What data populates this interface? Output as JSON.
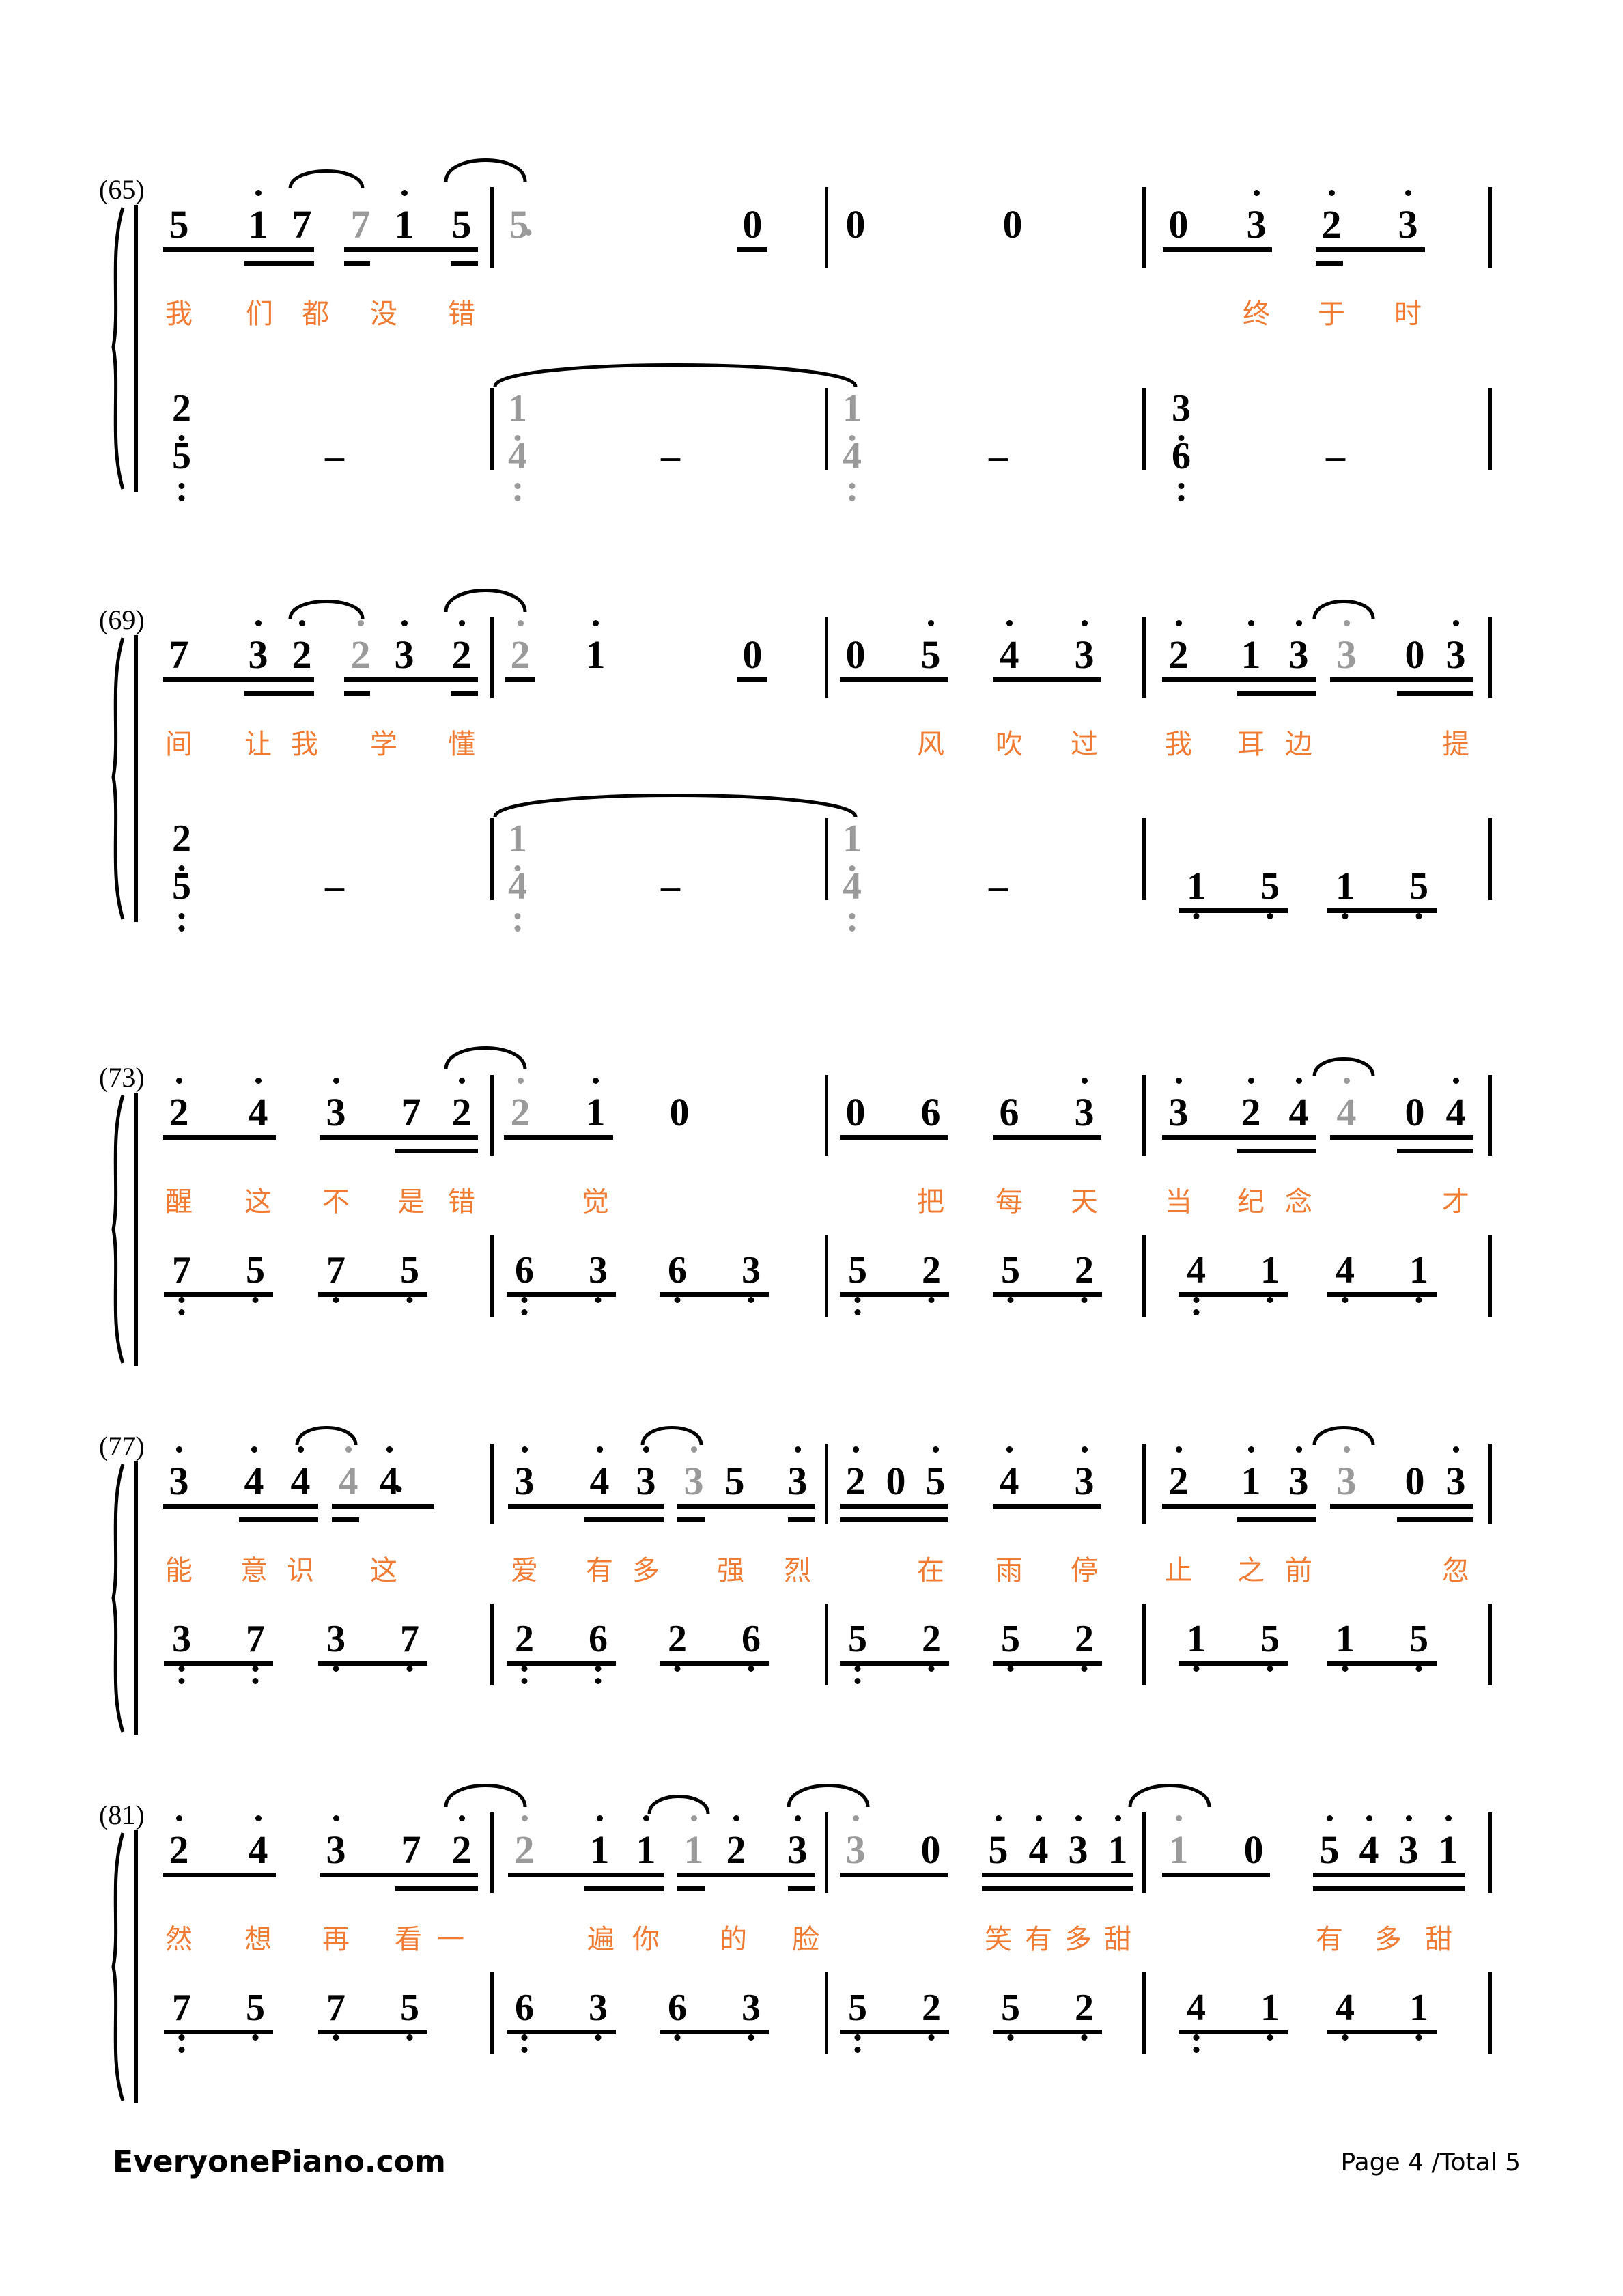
{
  "document": {
    "type": "numbered-musical-notation-piano-score",
    "page_label": "Page 4 /Total 5",
    "brand": "EveryonePiano.com",
    "accent_color": "#F07B33",
    "tied_note_color": "#9A9A9A"
  },
  "systems": [
    {
      "measure_number": "(65)",
      "melody_lyrics": [
        "我",
        "们",
        "都",
        "没",
        "错",
        "终",
        "于",
        "时"
      ],
      "melody_notes": [
        {
          "d": "5"
        },
        {
          "d": "1",
          "oct": "up"
        },
        {
          "d": "7"
        },
        {
          "d": "7",
          "tied": true
        },
        {
          "d": "1",
          "oct": "up"
        },
        {
          "d": "5"
        },
        {
          "d": "5",
          "tied": true,
          "dot": true
        },
        {
          "d": "0"
        },
        {
          "d": "0"
        },
        {
          "d": "0"
        },
        {
          "d": "0"
        },
        {
          "d": "3",
          "oct": "up"
        },
        {
          "d": "2",
          "oct": "up"
        },
        {
          "d": "3",
          "oct": "up"
        }
      ],
      "bass_notes": [
        {
          "d": "2",
          "oct": "dn1"
        },
        {
          "d": "5",
          "oct": "dn2"
        },
        {
          "d": "-"
        },
        {
          "d": "1",
          "oct": "dn1",
          "tied": true
        },
        {
          "d": "4",
          "oct": "dn2",
          "tied": true
        },
        {
          "d": "-"
        },
        {
          "d": "1",
          "oct": "dn1",
          "tied": true
        },
        {
          "d": "4",
          "oct": "dn2",
          "tied": true
        },
        {
          "d": "-"
        },
        {
          "d": "3",
          "oct": "dn1"
        },
        {
          "d": "6",
          "oct": "dn2"
        },
        {
          "d": "-"
        }
      ]
    },
    {
      "measure_number": "(69)",
      "melody_lyrics": [
        "间",
        "让",
        "我",
        "学",
        "懂",
        "风",
        "吹",
        "过",
        "我",
        "耳",
        "边",
        "提"
      ],
      "melody_notes": [
        {
          "d": "7"
        },
        {
          "d": "3",
          "oct": "up"
        },
        {
          "d": "2",
          "oct": "up"
        },
        {
          "d": "2",
          "oct": "up",
          "tied": true
        },
        {
          "d": "3"
        },
        {
          "d": "2",
          "oct": "up"
        },
        {
          "d": "2",
          "oct": "up",
          "tied": true
        },
        {
          "d": "1",
          "oct": "up"
        },
        {
          "d": "0"
        },
        {
          "d": "0"
        },
        {
          "d": "5",
          "oct": "up"
        },
        {
          "d": "4",
          "oct": "up"
        },
        {
          "d": "3",
          "oct": "up"
        },
        {
          "d": "2",
          "oct": "up"
        },
        {
          "d": "1",
          "oct": "up"
        },
        {
          "d": "3",
          "oct": "up"
        },
        {
          "d": "3",
          "oct": "up",
          "tied": true
        },
        {
          "d": "0"
        },
        {
          "d": "3",
          "oct": "up"
        }
      ],
      "bass_notes": [
        {
          "d": "2",
          "oct": "dn1"
        },
        {
          "d": "5",
          "oct": "dn2"
        },
        {
          "d": "-"
        },
        {
          "d": "1",
          "oct": "dn1",
          "tied": true
        },
        {
          "d": "4",
          "oct": "dn2",
          "tied": true
        },
        {
          "d": "-"
        },
        {
          "d": "1",
          "oct": "dn1",
          "tied": true
        },
        {
          "d": "4",
          "oct": "dn2",
          "tied": true
        },
        {
          "d": "-"
        },
        {
          "d": "1",
          "oct": "dn1"
        },
        {
          "d": "5",
          "oct": "dn1"
        },
        {
          "d": "1",
          "oct": "dn1"
        },
        {
          "d": "5",
          "oct": "dn1"
        }
      ]
    },
    {
      "measure_number": "(73)",
      "melody_lyrics": [
        "醒",
        "这",
        "不",
        "是",
        "错",
        "觉",
        "把",
        "每",
        "天",
        "当",
        "纪",
        "念",
        "才"
      ],
      "melody_notes": [
        {
          "d": "2",
          "oct": "up"
        },
        {
          "d": "4",
          "oct": "up"
        },
        {
          "d": "3",
          "oct": "up"
        },
        {
          "d": "7"
        },
        {
          "d": "2",
          "oct": "up"
        },
        {
          "d": "2",
          "oct": "up",
          "tied": true
        },
        {
          "d": "1",
          "oct": "up"
        },
        {
          "d": "0"
        },
        {
          "d": "0"
        },
        {
          "d": "6"
        },
        {
          "d": "6"
        },
        {
          "d": "3",
          "oct": "up"
        },
        {
          "d": "3",
          "oct": "up"
        },
        {
          "d": "2",
          "oct": "up"
        },
        {
          "d": "4",
          "oct": "up"
        },
        {
          "d": "4",
          "oct": "up",
          "tied": true
        },
        {
          "d": "0"
        },
        {
          "d": "4",
          "oct": "up"
        }
      ],
      "bass_notes": [
        {
          "d": "7",
          "oct": "dn2"
        },
        {
          "d": "5",
          "oct": "dn1"
        },
        {
          "d": "7",
          "oct": "dn1"
        },
        {
          "d": "5",
          "oct": "dn1"
        },
        {
          "d": "6",
          "oct": "dn2"
        },
        {
          "d": "3",
          "oct": "dn1"
        },
        {
          "d": "6",
          "oct": "dn1"
        },
        {
          "d": "3",
          "oct": "dn1"
        },
        {
          "d": "5",
          "oct": "dn2"
        },
        {
          "d": "2",
          "oct": "dn1"
        },
        {
          "d": "5",
          "oct": "dn1"
        },
        {
          "d": "2",
          "oct": "dn1"
        },
        {
          "d": "4",
          "oct": "dn2"
        },
        {
          "d": "1",
          "oct": "dn1"
        },
        {
          "d": "4",
          "oct": "dn1"
        },
        {
          "d": "1",
          "oct": "dn1"
        }
      ]
    },
    {
      "measure_number": "(77)",
      "melody_lyrics": [
        "能",
        "意",
        "识",
        "这",
        "爱",
        "有",
        "多",
        "强",
        "烈",
        "在",
        "雨",
        "停",
        "止",
        "之",
        "前",
        "忽"
      ],
      "melody_notes": [
        {
          "d": "3",
          "oct": "up"
        },
        {
          "d": "4",
          "oct": "up"
        },
        {
          "d": "4",
          "oct": "up"
        },
        {
          "d": "4",
          "oct": "up",
          "tied": true
        },
        {
          "d": "4",
          "oct": "up",
          "dot": true
        },
        {
          "d": "3",
          "oct": "up"
        },
        {
          "d": "4",
          "oct": "up"
        },
        {
          "d": "3",
          "oct": "up"
        },
        {
          "d": "3",
          "oct": "up",
          "tied": true
        },
        {
          "d": "5"
        },
        {
          "d": "3",
          "oct": "up"
        },
        {
          "d": "2",
          "oct": "up"
        },
        {
          "d": "0"
        },
        {
          "d": "5",
          "oct": "up"
        },
        {
          "d": "4",
          "oct": "up"
        },
        {
          "d": "3",
          "oct": "up"
        },
        {
          "d": "2",
          "oct": "up"
        },
        {
          "d": "1",
          "oct": "up"
        },
        {
          "d": "3",
          "oct": "up"
        },
        {
          "d": "3",
          "oct": "up",
          "tied": true
        },
        {
          "d": "0"
        },
        {
          "d": "3",
          "oct": "up"
        }
      ],
      "bass_notes": [
        {
          "d": "3",
          "oct": "dn2"
        },
        {
          "d": "7",
          "oct": "dn2"
        },
        {
          "d": "3",
          "oct": "dn1"
        },
        {
          "d": "7",
          "oct": "dn1"
        },
        {
          "d": "2",
          "oct": "dn2"
        },
        {
          "d": "6",
          "oct": "dn2"
        },
        {
          "d": "2",
          "oct": "dn1"
        },
        {
          "d": "6",
          "oct": "dn1"
        },
        {
          "d": "5",
          "oct": "dn2"
        },
        {
          "d": "2",
          "oct": "dn1"
        },
        {
          "d": "5",
          "oct": "dn1"
        },
        {
          "d": "2",
          "oct": "dn1"
        },
        {
          "d": "1",
          "oct": "dn1"
        },
        {
          "d": "5",
          "oct": "dn1"
        },
        {
          "d": "1",
          "oct": "dn1"
        },
        {
          "d": "5",
          "oct": "dn1"
        }
      ]
    },
    {
      "measure_number": "(81)",
      "melody_lyrics": [
        "然",
        "想",
        "再",
        "看",
        "一",
        "遍",
        "你",
        "的",
        "脸",
        "笑",
        "有",
        "多",
        "甜",
        "有",
        "多",
        "甜"
      ],
      "melody_notes": [
        {
          "d": "2",
          "oct": "up"
        },
        {
          "d": "4",
          "oct": "up"
        },
        {
          "d": "3",
          "oct": "up"
        },
        {
          "d": "7"
        },
        {
          "d": "2",
          "oct": "up"
        },
        {
          "d": "2",
          "oct": "up",
          "tied": true
        },
        {
          "d": "1",
          "oct": "up"
        },
        {
          "d": "1",
          "oct": "up"
        },
        {
          "d": "1",
          "oct": "up",
          "tied": true
        },
        {
          "d": "2",
          "oct": "up"
        },
        {
          "d": "3",
          "oct": "up"
        },
        {
          "d": "3",
          "oct": "up",
          "tied": true
        },
        {
          "d": "0"
        },
        {
          "d": "5",
          "oct": "up"
        },
        {
          "d": "4",
          "oct": "up"
        },
        {
          "d": "3",
          "oct": "up"
        },
        {
          "d": "1",
          "oct": "up"
        },
        {
          "d": "1",
          "oct": "up",
          "tied": true
        },
        {
          "d": "0"
        },
        {
          "d": "5",
          "oct": "up"
        },
        {
          "d": "4",
          "oct": "up"
        },
        {
          "d": "3",
          "oct": "up"
        },
        {
          "d": "1",
          "oct": "up"
        }
      ],
      "bass_notes": [
        {
          "d": "7",
          "oct": "dn2"
        },
        {
          "d": "5",
          "oct": "dn1"
        },
        {
          "d": "7",
          "oct": "dn1"
        },
        {
          "d": "5",
          "oct": "dn1"
        },
        {
          "d": "6",
          "oct": "dn2"
        },
        {
          "d": "3",
          "oct": "dn1"
        },
        {
          "d": "6",
          "oct": "dn1"
        },
        {
          "d": "3",
          "oct": "dn1"
        },
        {
          "d": "5",
          "oct": "dn2"
        },
        {
          "d": "2",
          "oct": "dn1"
        },
        {
          "d": "5",
          "oct": "dn1"
        },
        {
          "d": "2",
          "oct": "dn1"
        },
        {
          "d": "4",
          "oct": "dn2"
        },
        {
          "d": "1",
          "oct": "dn1"
        },
        {
          "d": "4",
          "oct": "dn1"
        },
        {
          "d": "1",
          "oct": "dn1"
        }
      ]
    }
  ],
  "s1": {
    "num": "(65)",
    "m": {
      "a1": "5",
      "a2": "1",
      "a3": "7",
      "a4": "7",
      "a5": "1",
      "a6": "5",
      "b1": "5",
      "b2": "0",
      "c1": "0",
      "c2": "0",
      "d1": "0",
      "d2": "3",
      "d3": "2",
      "d4": "3"
    },
    "ly": {
      "l1": "我",
      "l2": "们",
      "l3": "都",
      "l4": "没",
      "l5": "错",
      "l6": "终",
      "l7": "于",
      "l8": "时"
    },
    "bs": {
      "m1a": "2",
      "m1b": "5",
      "m1d": "–",
      "m2a": "1",
      "m2b": "4",
      "m2d": "–",
      "m3a": "1",
      "m3b": "4",
      "m3d": "–",
      "m4a": "3",
      "m4b": "6",
      "m4d": "–"
    }
  },
  "s2": {
    "num": "(69)",
    "m": {
      "a1": "7",
      "a2": "3",
      "a3": "2",
      "a4": "2",
      "a5": "3",
      "a6": "2",
      "b1": "2",
      "b2": "1",
      "b3": "0",
      "c1": "0",
      "c2": "5",
      "c3": "4",
      "c4": "3",
      "d1": "2",
      "d2": "1",
      "d3": "3",
      "d4": "3",
      "d5": "0",
      "d6": "3"
    },
    "ly": {
      "l1": "间",
      "l2": "让",
      "l3": "我",
      "l4": "学",
      "l5": "懂",
      "l6": "风",
      "l7": "吹",
      "l8": "过",
      "l9": "我",
      "l10": "耳",
      "l11": "边",
      "l12": "提"
    },
    "bs": {
      "m1a": "2",
      "m1b": "5",
      "m1d": "–",
      "m2a": "1",
      "m2b": "4",
      "m2d": "–",
      "m3a": "1",
      "m3b": "4",
      "m3d": "–",
      "m4a": "1",
      "m4b": "5",
      "m4c": "1",
      "m4d": "5"
    }
  },
  "s3": {
    "num": "(73)",
    "m": {
      "a1": "2",
      "a2": "4",
      "a3": "3",
      "a4": "7",
      "a5": "2",
      "b1": "2",
      "b2": "1",
      "b3": "0",
      "c1": "0",
      "c2": "6",
      "c3": "6",
      "c4": "3",
      "d1": "3",
      "d2": "2",
      "d3": "4",
      "d4": "4",
      "d5": "0",
      "d6": "4"
    },
    "ly": {
      "l1": "醒",
      "l2": "这",
      "l3": "不",
      "l4": "是",
      "l5": "错",
      "l6": "觉",
      "l7": "把",
      "l8": "每",
      "l9": "天",
      "l10": "当",
      "l11": "纪",
      "l12": "念",
      "l13": "才"
    },
    "bs": {
      "m1a": "7",
      "m1b": "5",
      "m1c": "7",
      "m1d": "5",
      "m2a": "6",
      "m2b": "3",
      "m2c": "6",
      "m2d": "3",
      "m3a": "5",
      "m3b": "2",
      "m3c": "5",
      "m3d": "2",
      "m4a": "4",
      "m4b": "1",
      "m4c": "4",
      "m4d": "1"
    }
  },
  "s4": {
    "num": "(77)",
    "m": {
      "a1": "3",
      "a2": "4",
      "a3": "4",
      "a4": "4",
      "a5": "4",
      "b1": "3",
      "b2": "4",
      "b3": "3",
      "b4": "3",
      "b5": "5",
      "b6": "3",
      "c1": "2",
      "c2": "0",
      "c3": "5",
      "c4": "4",
      "c5": "3",
      "d1": "2",
      "d2": "1",
      "d3": "3",
      "d4": "3",
      "d5": "0",
      "d6": "3"
    },
    "ly": {
      "l1": "能",
      "l2": "意",
      "l3": "识",
      "l4": "这",
      "l5": "爱",
      "l6": "有",
      "l7": "多",
      "l8": "强",
      "l9": "烈",
      "l10": "在",
      "l11": "雨",
      "l12": "停",
      "l13": "止",
      "l14": "之",
      "l15": "前",
      "l16": "忽"
    },
    "bs": {
      "m1a": "3",
      "m1b": "7",
      "m1c": "3",
      "m1d": "7",
      "m2a": "2",
      "m2b": "6",
      "m2c": "2",
      "m2d": "6",
      "m3a": "5",
      "m3b": "2",
      "m3c": "5",
      "m3d": "2",
      "m4a": "1",
      "m4b": "5",
      "m4c": "1",
      "m4d": "5"
    }
  },
  "s5": {
    "num": "(81)",
    "m": {
      "a1": "2",
      "a2": "4",
      "a3": "3",
      "a4": "7",
      "a5": "2",
      "b1": "2",
      "b2": "1",
      "b3": "1",
      "b4": "1",
      "b5": "2",
      "b6": "3",
      "c1": "3",
      "c2": "0",
      "c3": "5",
      "c4": "4",
      "c5": "3",
      "c6": "1",
      "d1": "1",
      "d2": "0",
      "d3": "5",
      "d4": "4",
      "d5": "3",
      "d6": "1"
    },
    "ly": {
      "l1": "然",
      "l2": "想",
      "l3": "再",
      "l4": "看",
      "l5": "一",
      "l6": "遍",
      "l7": "你",
      "l8": "的",
      "l9": "脸",
      "l10": "笑",
      "l11": "有",
      "l12": "多",
      "l13": "甜",
      "l14": "有",
      "l15": "多",
      "l16": "甜"
    },
    "bs": {
      "m1a": "7",
      "m1b": "5",
      "m1c": "7",
      "m1d": "5",
      "m2a": "6",
      "m2b": "3",
      "m2c": "6",
      "m2d": "3",
      "m3a": "5",
      "m3b": "2",
      "m3c": "5",
      "m3d": "2",
      "m4a": "4",
      "m4b": "1",
      "m4c": "4",
      "m4d": "1"
    }
  },
  "footer": {
    "brand": "EveryonePiano.com",
    "page": "Page 4 /Total 5"
  },
  "chart_data": {
    "type": "table",
    "title": "Numbered musical notation (jianpu) piano score — page 4",
    "columns": [
      "measure",
      "melody",
      "lyrics",
      "bass"
    ],
    "rows": [
      {
        "measure": "65-68",
        "melody": "5 1̇ 7 7 1̇ 5 | 5· 0 | 0 0 | 0 3̇ 2̇ 3̇",
        "lyrics": "我们都没错 终于时",
        "bass": "2̣5̤ – | 1̣4̤ – | 1̣4̤ – | 3̣6̤ –"
      },
      {
        "measure": "69-72",
        "melody": "7 3̇ 2̇ 2̇ 3 2̇ | 2̇ 1̇ 0 | 0 5̇ 4̇ 3̇ | 2̇ 1̇ 3̇ 3̇ 0 3̇",
        "lyrics": "间让我学懂 风吹过我耳边 提",
        "bass": "2̣5̤ – | 1̣4̤ – | 1̣4̤ – | 1̣ 5̣ 1̣ 5̣"
      },
      {
        "measure": "73-76",
        "melody": "2̇ 4̇ 3̇ 7 2̇ | 2̇ 1̇ 0 | 0 6 6 3̇ | 3̇ 2̇ 4̇ 4̇ 0 4̇",
        "lyrics": "醒这不是错觉 把每天当纪念 才",
        "bass": "7̤ 5̣ 7̣ 5̣ | 6̤ 3̣ 6̣ 3̣ | 5̤ 2̣ 5̣ 2̣ | 4̤ 1̣ 4̣ 1̣"
      },
      {
        "measure": "77-80",
        "melody": "3̇ 4̇ 4̇ 4̇ 4̇· | 3̇ 4̇ 3̇ 3̇ 5 3̇ | 2̇ 0 5̇ 4̇ 3̇ | 2̇ 1̇ 3̇ 3̇ 0 3̇",
        "lyrics": "能意识这 爱有多强烈 在雨停止之前 忽",
        "bass": "3̤ 7̤ 3̣ 7̣ | 2̤ 6̤ 2̣ 6̣ | 5̤ 2̣ 5̣ 2̣ | 1̣ 5̣ 1̣ 5̣"
      },
      {
        "measure": "81-84",
        "melody": "2̇ 4̇ 3̇ 7 2̇ | 2̇ 1̇ 1̇ 1̇ 2̇ 3̇ | 3̇ 0 5̇4̇3̇1̇ | 1̇ 0 5̇4̇3̇1̇",
        "lyrics": "然想再看一遍你的脸 笑有多甜 有多甜",
        "bass": "7̤ 5̣ 7̣ 5̣ | 6̤ 3̣ 6̣ 3̣ | 5̤ 2̣ 5̣ 2̣ | 4̤ 1̣ 4̣ 1̣"
      }
    ]
  }
}
